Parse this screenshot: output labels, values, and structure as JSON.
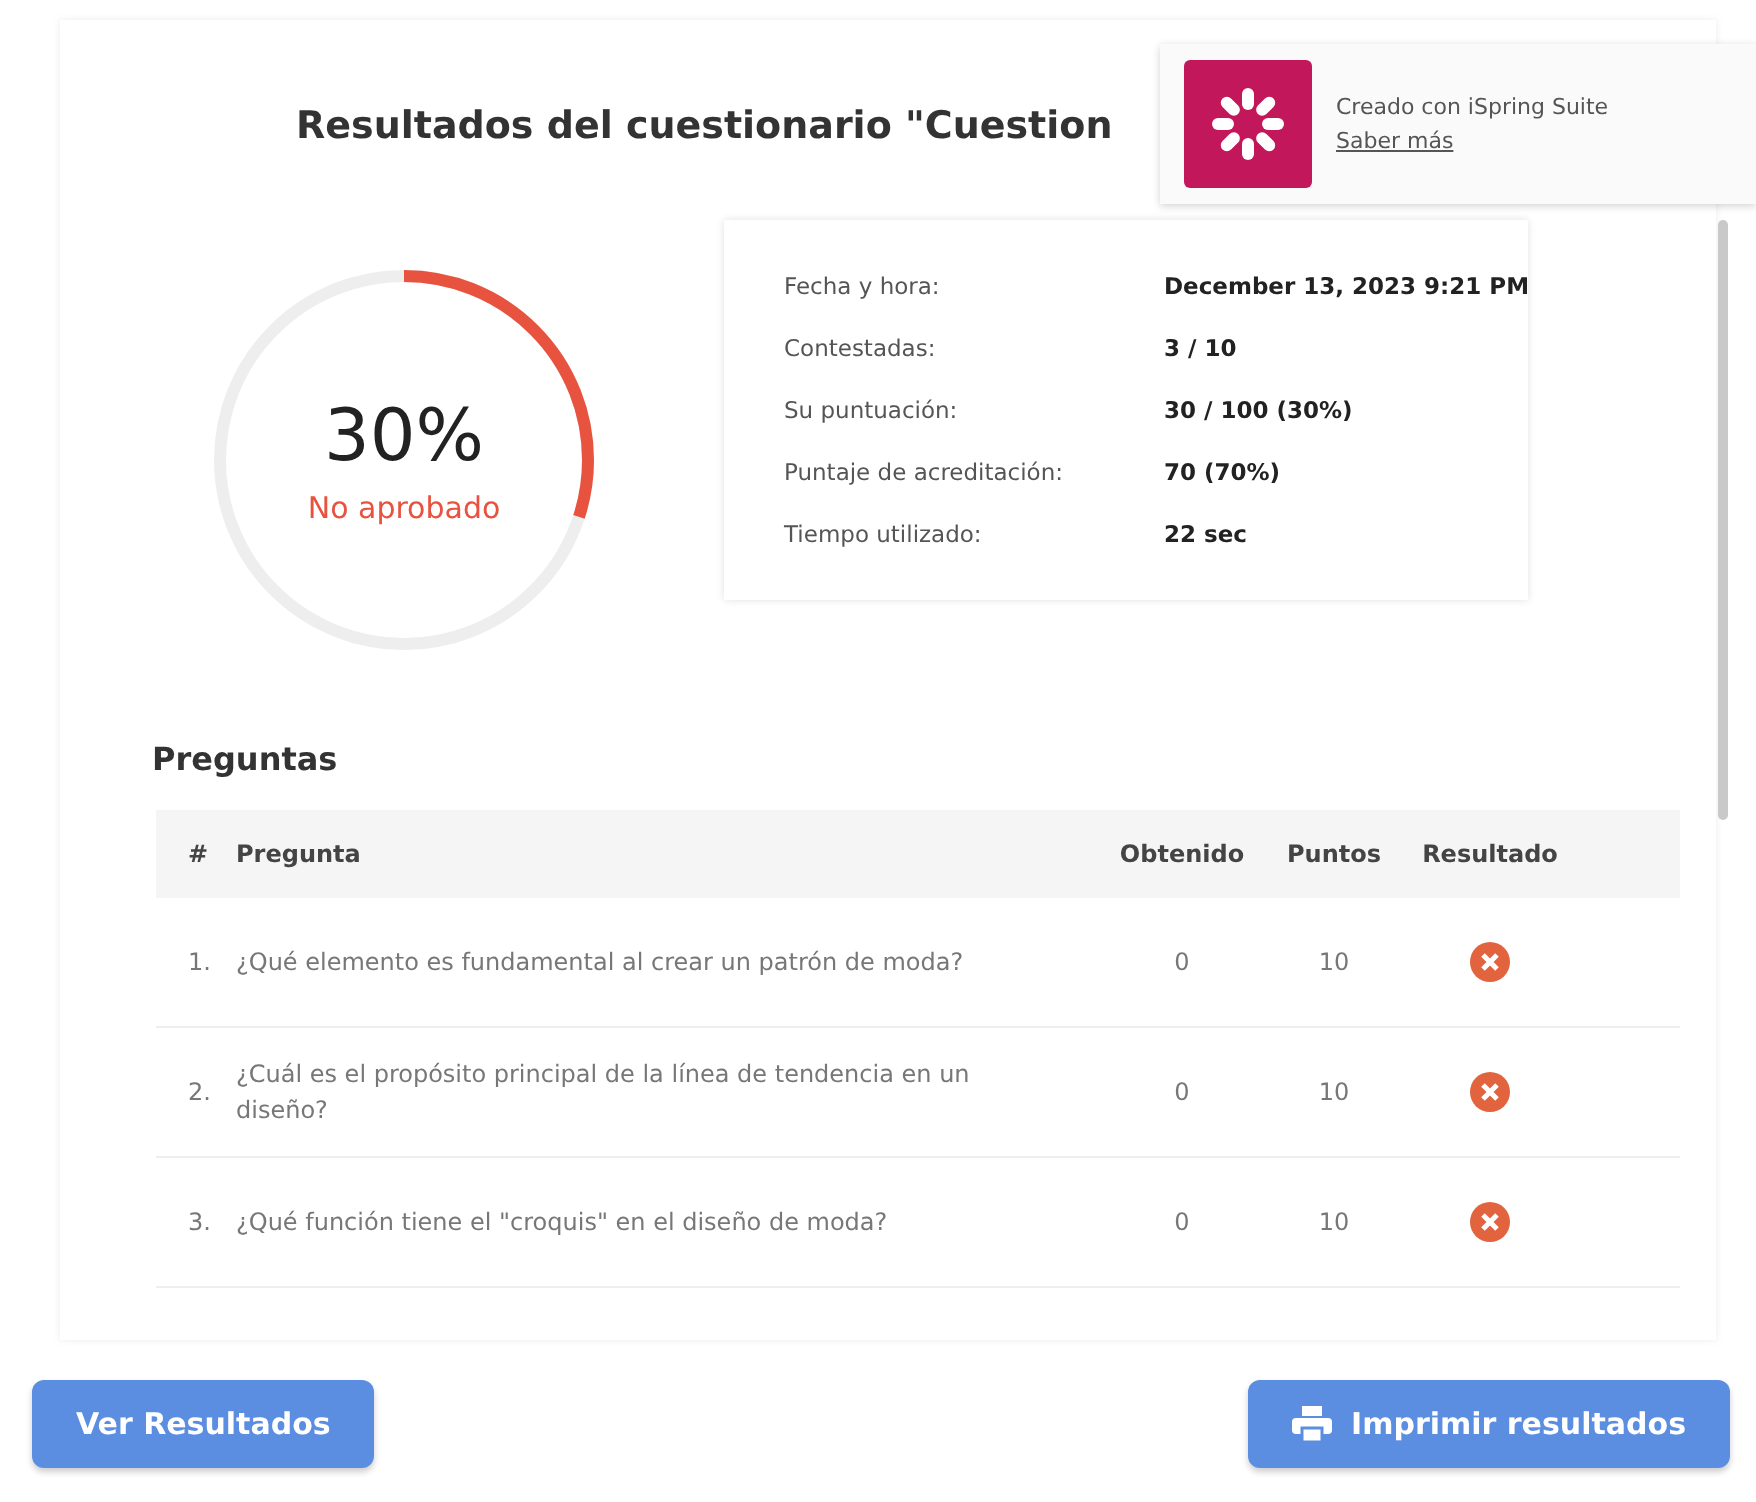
{
  "title": "Resultados del cuestionario \"Cuestion",
  "promo": {
    "text": "Creado con iSpring Suite",
    "link": "Saber más"
  },
  "score": {
    "percent": "30%",
    "status": "No aprobado",
    "level": 0.3,
    "passed": false
  },
  "details": [
    {
      "label": "Fecha y hora:",
      "value": "December 13, 2023 9:21 PM"
    },
    {
      "label": "Contestadas:",
      "value": "3 / 10"
    },
    {
      "label": "Su puntuación:",
      "value": "30 / 100 (30%)"
    },
    {
      "label": "Puntaje de acreditación:",
      "value": "70 (70%)"
    },
    {
      "label": "Tiempo utilizado:",
      "value": "22 sec"
    }
  ],
  "questions_heading": "Preguntas",
  "table": {
    "columns": [
      "#",
      "Pregunta",
      "Obtenido",
      "Puntos",
      "Resultado"
    ],
    "rows": [
      {
        "number": "1.",
        "question": "¿Qué elemento es fundamental al crear un patrón de moda?",
        "obtained": "0",
        "points": "10",
        "correct": false
      },
      {
        "number": "2.",
        "question": "¿Cuál es el propósito principal de la línea de tendencia en un diseño?",
        "obtained": "0",
        "points": "10",
        "correct": false
      },
      {
        "number": "3.",
        "question": "¿Qué función tiene el \"croquis\" en el diseño de moda?",
        "obtained": "0",
        "points": "10",
        "correct": false
      }
    ]
  },
  "buttons": {
    "view": "Ver Resultados",
    "print": "Imprimir resultados"
  }
}
